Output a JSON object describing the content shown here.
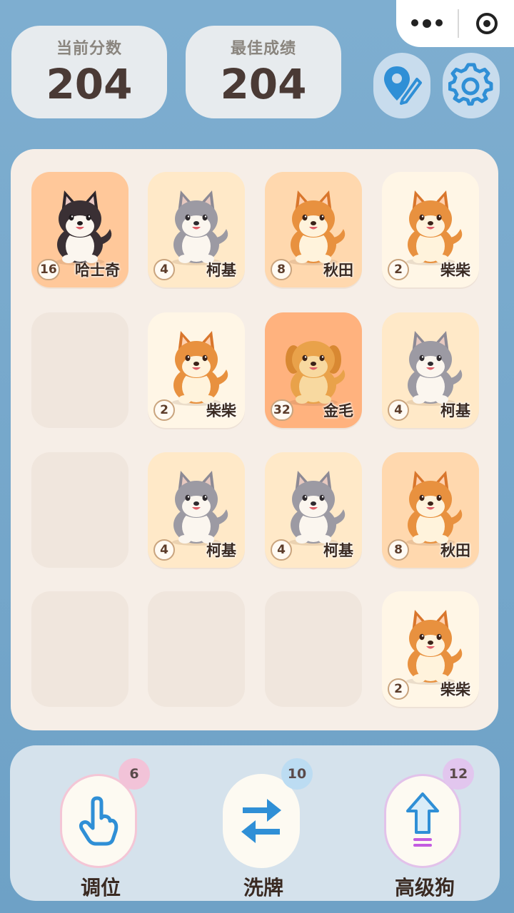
{
  "scores": {
    "current_label": "当前分数",
    "current_value": "204",
    "best_label": "最佳成绩",
    "best_value": "204"
  },
  "header_buttons": [
    "location-edit-icon",
    "gear-icon"
  ],
  "board": {
    "rows": [
      [
        {
          "value": "16",
          "name": "哈士奇",
          "breed": "husky",
          "color": "#ffc89a"
        },
        {
          "value": "4",
          "name": "柯基",
          "breed": "corgi",
          "color": "#ffe9c8"
        },
        {
          "value": "8",
          "name": "秋田",
          "breed": "shiba",
          "color": "#ffd8ae"
        },
        {
          "value": "2",
          "name": "柴柴",
          "breed": "shiba",
          "color": "#fff6e6"
        }
      ],
      [
        {
          "value": "",
          "name": "",
          "breed": "",
          "color": ""
        },
        {
          "value": "2",
          "name": "柴柴",
          "breed": "shiba",
          "color": "#fff6e6"
        },
        {
          "value": "32",
          "name": "金毛",
          "breed": "golden",
          "color": "#ffb27e"
        },
        {
          "value": "4",
          "name": "柯基",
          "breed": "corgi",
          "color": "#ffe9c8"
        }
      ],
      [
        {
          "value": "",
          "name": "",
          "breed": "",
          "color": ""
        },
        {
          "value": "4",
          "name": "柯基",
          "breed": "corgi",
          "color": "#ffe9c8"
        },
        {
          "value": "4",
          "name": "柯基",
          "breed": "corgi",
          "color": "#ffe9c8"
        },
        {
          "value": "8",
          "name": "秋田",
          "breed": "shiba",
          "color": "#ffd8ae"
        }
      ],
      [
        {
          "value": "",
          "name": "",
          "breed": "",
          "color": ""
        },
        {
          "value": "",
          "name": "",
          "breed": "",
          "color": ""
        },
        {
          "value": "",
          "name": "",
          "breed": "",
          "color": ""
        },
        {
          "value": "2",
          "name": "柴柴",
          "breed": "shiba",
          "color": "#fff6e6"
        }
      ]
    ]
  },
  "tools": [
    {
      "label": "调位",
      "count": "6",
      "icon": "hand-pointer-icon",
      "badge_color": "#f2c3d8",
      "border": "#f4c6d6"
    },
    {
      "label": "洗牌",
      "count": "10",
      "icon": "shuffle-icon",
      "badge_color": "#bcdcf2",
      "border": "#fdfaf2"
    },
    {
      "label": "高级狗",
      "count": "12",
      "icon": "upgrade-arrow-icon",
      "badge_color": "#e2c6ee",
      "border": "#e2c2ea"
    }
  ]
}
